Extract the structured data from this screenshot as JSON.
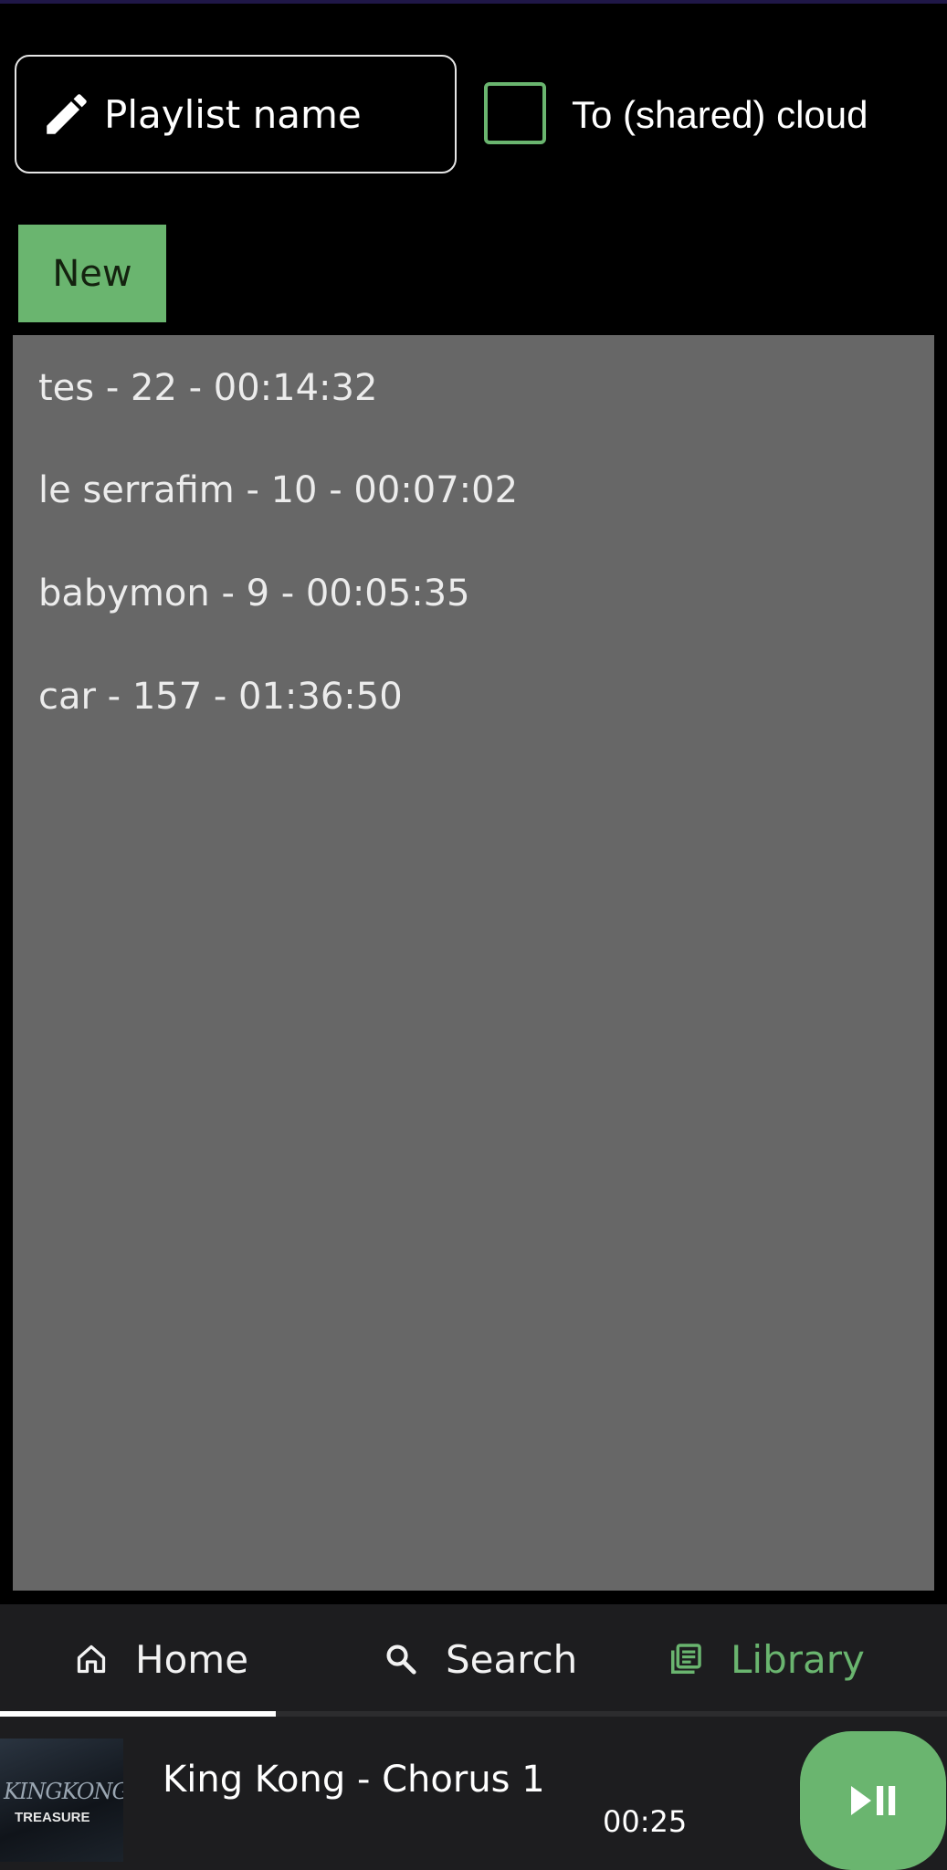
{
  "form": {
    "playlist_name_placeholder": "Playlist name",
    "playlist_name_value": "",
    "cloud_checkbox_label": "To (shared) cloud",
    "cloud_checkbox_checked": false,
    "new_button_label": "New"
  },
  "playlists": [
    "tes - 22 - 00:14:32",
    "le serrafim - 10 - 00:07:02",
    "babymon - 9 - 00:05:35",
    "car - 157 - 01:36:50"
  ],
  "nav": {
    "items": [
      {
        "label": "Home",
        "icon": "home-icon",
        "active": false
      },
      {
        "label": "Search",
        "icon": "search-icon",
        "active": false
      },
      {
        "label": "Library",
        "icon": "library-icon",
        "active": true
      }
    ]
  },
  "player": {
    "track_title": "King Kong - Chorus 1",
    "elapsed": "00:25",
    "album_art_text_title": "KINGKONG",
    "album_art_text_sub": "TREASURE",
    "play_pause_icon": "play-pause-icon"
  },
  "colors": {
    "accent": "#6ab56f",
    "list_background": "#676767",
    "background": "#000000",
    "nav_background": "#1d1d1f"
  }
}
